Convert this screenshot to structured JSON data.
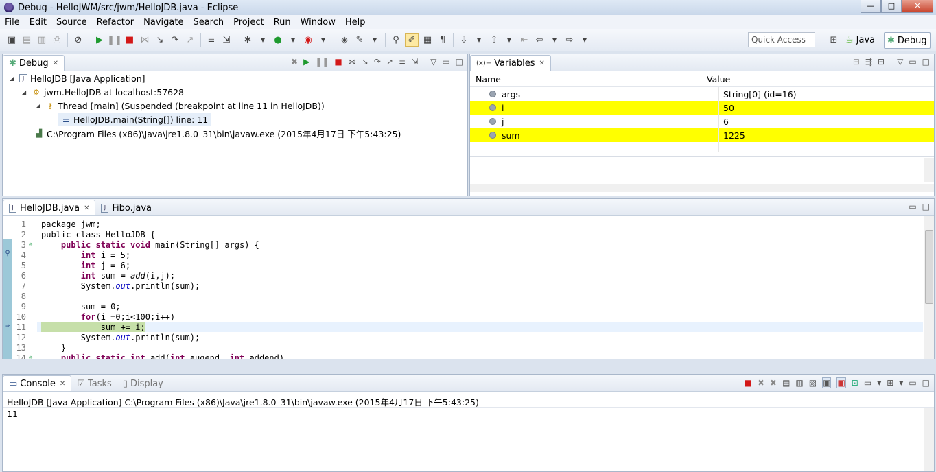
{
  "window": {
    "title": "Debug - HelloJWM/src/jwm/HelloJDB.java - Eclipse",
    "minimize": "—",
    "maximize": "□",
    "close": "✕"
  },
  "menu": [
    "File",
    "Edit",
    "Source",
    "Refactor",
    "Navigate",
    "Search",
    "Project",
    "Run",
    "Window",
    "Help"
  ],
  "toolbar": {
    "quick_access_placeholder": "Quick Access"
  },
  "perspectives": {
    "java": "Java",
    "debug": "Debug"
  },
  "debug_view": {
    "tab": "Debug",
    "tree": [
      {
        "label": "HelloJDB [Java Application]"
      },
      {
        "label": "jwm.HelloJDB at localhost:57628"
      },
      {
        "label": "Thread [main] (Suspended (breakpoint at line 11 in HelloJDB))"
      },
      {
        "label": "HelloJDB.main(String[]) line: 11"
      },
      {
        "label": "C:\\Program Files (x86)\\Java\\jre1.8.0_31\\bin\\javaw.exe (2015年4月17日 下午5:43:25)"
      }
    ]
  },
  "variables_view": {
    "tab": "Variables",
    "columns": [
      "Name",
      "Value"
    ],
    "rows": [
      {
        "name": "args",
        "value": "String[0]  (id=16)"
      },
      {
        "name": "i",
        "value": "50"
      },
      {
        "name": "j",
        "value": "6"
      },
      {
        "name": "sum",
        "value": "1225"
      }
    ]
  },
  "editor": {
    "tabs": [
      "HelloJDB.java",
      "Fibo.java"
    ],
    "lines": [
      {
        "n": "1"
      },
      {
        "n": "2"
      },
      {
        "n": "3"
      },
      {
        "n": "4"
      },
      {
        "n": "5"
      },
      {
        "n": "6"
      },
      {
        "n": "7"
      },
      {
        "n": "8"
      },
      {
        "n": "9"
      },
      {
        "n": "10"
      },
      {
        "n": "11"
      },
      {
        "n": "12"
      },
      {
        "n": "13"
      },
      {
        "n": "14"
      }
    ],
    "code": {
      "l1": "package jwm;",
      "l2": "public class HelloJDB {",
      "l3a": "public static void",
      "l3b": " main(String[] args) {",
      "l4a": "int",
      "l4b": " i = 5;",
      "l5a": "int",
      "l5b": " j = 6;",
      "l6a": "int",
      "l6b": " sum = ",
      "l6c": "add",
      "l6d": "(i,j);",
      "l7a": "System.",
      "l7b": "out",
      "l7c": ".println(sum);",
      "l9": "sum = 0;",
      "l10a": "for",
      "l10b": "(i =0;i<100;i++)",
      "l11": "sum += i;",
      "l12a": "System.",
      "l12b": "out",
      "l12c": ".println(sum);",
      "l13": "}",
      "l14a": "public static int",
      "l14b": " add(",
      "l14c": "int",
      "l14d": " augend, ",
      "l14e": "int",
      "l14f": " addend)"
    }
  },
  "console_view": {
    "tabs": [
      "Console",
      "Tasks",
      "Display"
    ],
    "launch_label": "HelloJDB [Java Application] C:\\Program Files (x86)\\Java\\jre1.8.0_31\\bin\\javaw.exe (2015年4月17日 下午5:43:25)",
    "output": "11"
  }
}
